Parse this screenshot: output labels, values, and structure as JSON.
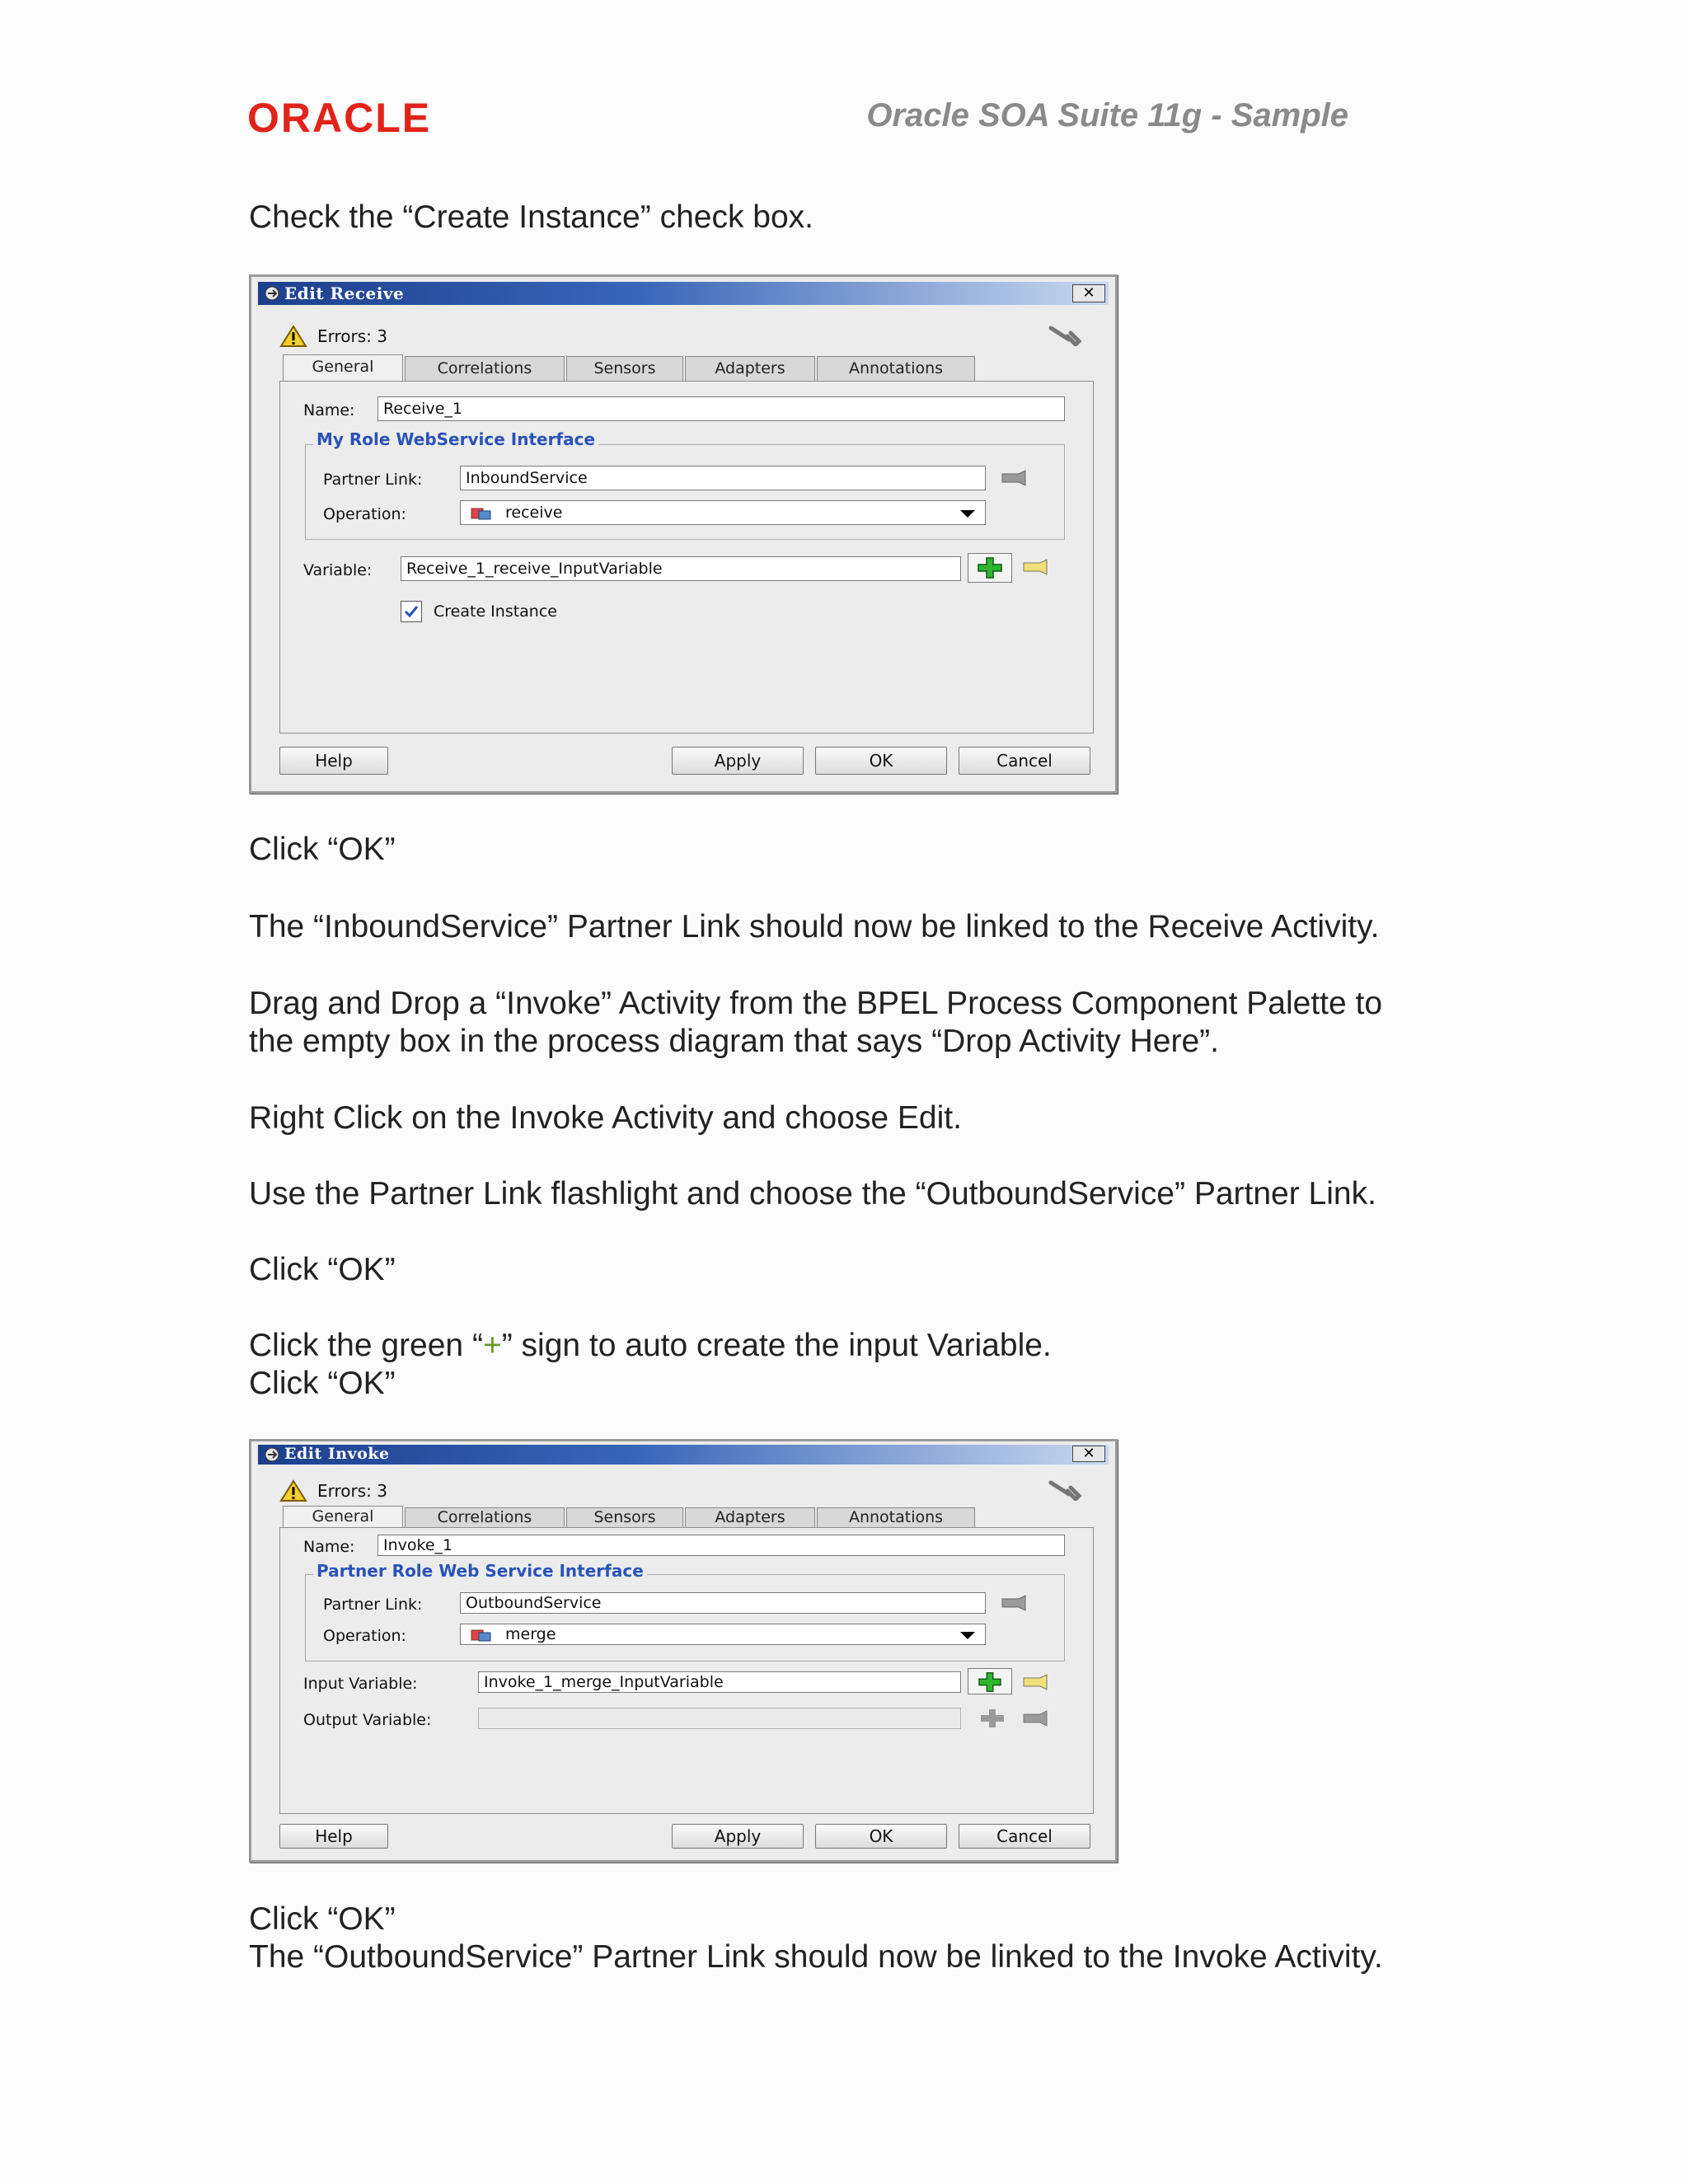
{
  "header": {
    "logo_text": "ORACLE",
    "doc_title": "Oracle SOA Suite 11g - Sample"
  },
  "paragraphs": {
    "p1": "Check the “Create Instance” check box.",
    "p2": "Click “OK”",
    "p3": "The “InboundService” Partner Link should now be linked to the Receive Activity.",
    "p4a": "Drag and Drop a “Invoke” Activity from the BPEL Process Component Palette to",
    "p4b": "the empty box in the process diagram that says “Drop Activity Here”.",
    "p5": "Right Click on the Invoke Activity and choose Edit.",
    "p6": "Use the Partner Link flashlight and choose the “OutboundService” Partner Link.",
    "p7": "Click “OK”",
    "p8_pre": "Click the green “",
    "p8_plus": "+",
    "p8_post": "” sign to auto create the input Variable.",
    "p9": "Click “OK”",
    "p10": "Click “OK”",
    "p11": "The “OutboundService” Partner Link should now be linked to the Invoke Activity."
  },
  "dialog_receive": {
    "title": "Edit Receive",
    "close": "✕",
    "errors": "Errors: 3",
    "tabs": [
      "General",
      "Correlations",
      "Sensors",
      "Adapters",
      "Annotations"
    ],
    "name_label": "Name:",
    "name_value": "Receive_1",
    "group_title": "My Role WebService Interface",
    "partner_link_label": "Partner Link:",
    "partner_link_value": "InboundService",
    "operation_label": "Operation:",
    "operation_value": "receive",
    "variable_label": "Variable:",
    "variable_value": "Receive_1_receive_InputVariable",
    "create_instance_label": "Create Instance",
    "create_instance_checked": true,
    "buttons": {
      "help": "Help",
      "apply": "Apply",
      "ok": "OK",
      "cancel": "Cancel"
    }
  },
  "dialog_invoke": {
    "title": "Edit Invoke",
    "close": "✕",
    "errors": "Errors: 3",
    "tabs": [
      "General",
      "Correlations",
      "Sensors",
      "Adapters",
      "Annotations"
    ],
    "name_label": "Name:",
    "name_value": "Invoke_1",
    "group_title": "Partner Role Web Service Interface",
    "partner_link_label": "Partner Link:",
    "partner_link_value": "OutboundService",
    "operation_label": "Operation:",
    "operation_value": "merge",
    "input_variable_label": "Input Variable:",
    "input_variable_value": "Invoke_1_merge_InputVariable",
    "output_variable_label": "Output Variable:",
    "output_variable_value": "",
    "buttons": {
      "help": "Help",
      "apply": "Apply",
      "ok": "OK",
      "cancel": "Cancel"
    }
  },
  "colors": {
    "oracle_red": "#e2231a",
    "legend_blue": "#2a53b8",
    "title_gray": "#8a8a8a",
    "plus_green": "#6a9a2a"
  }
}
